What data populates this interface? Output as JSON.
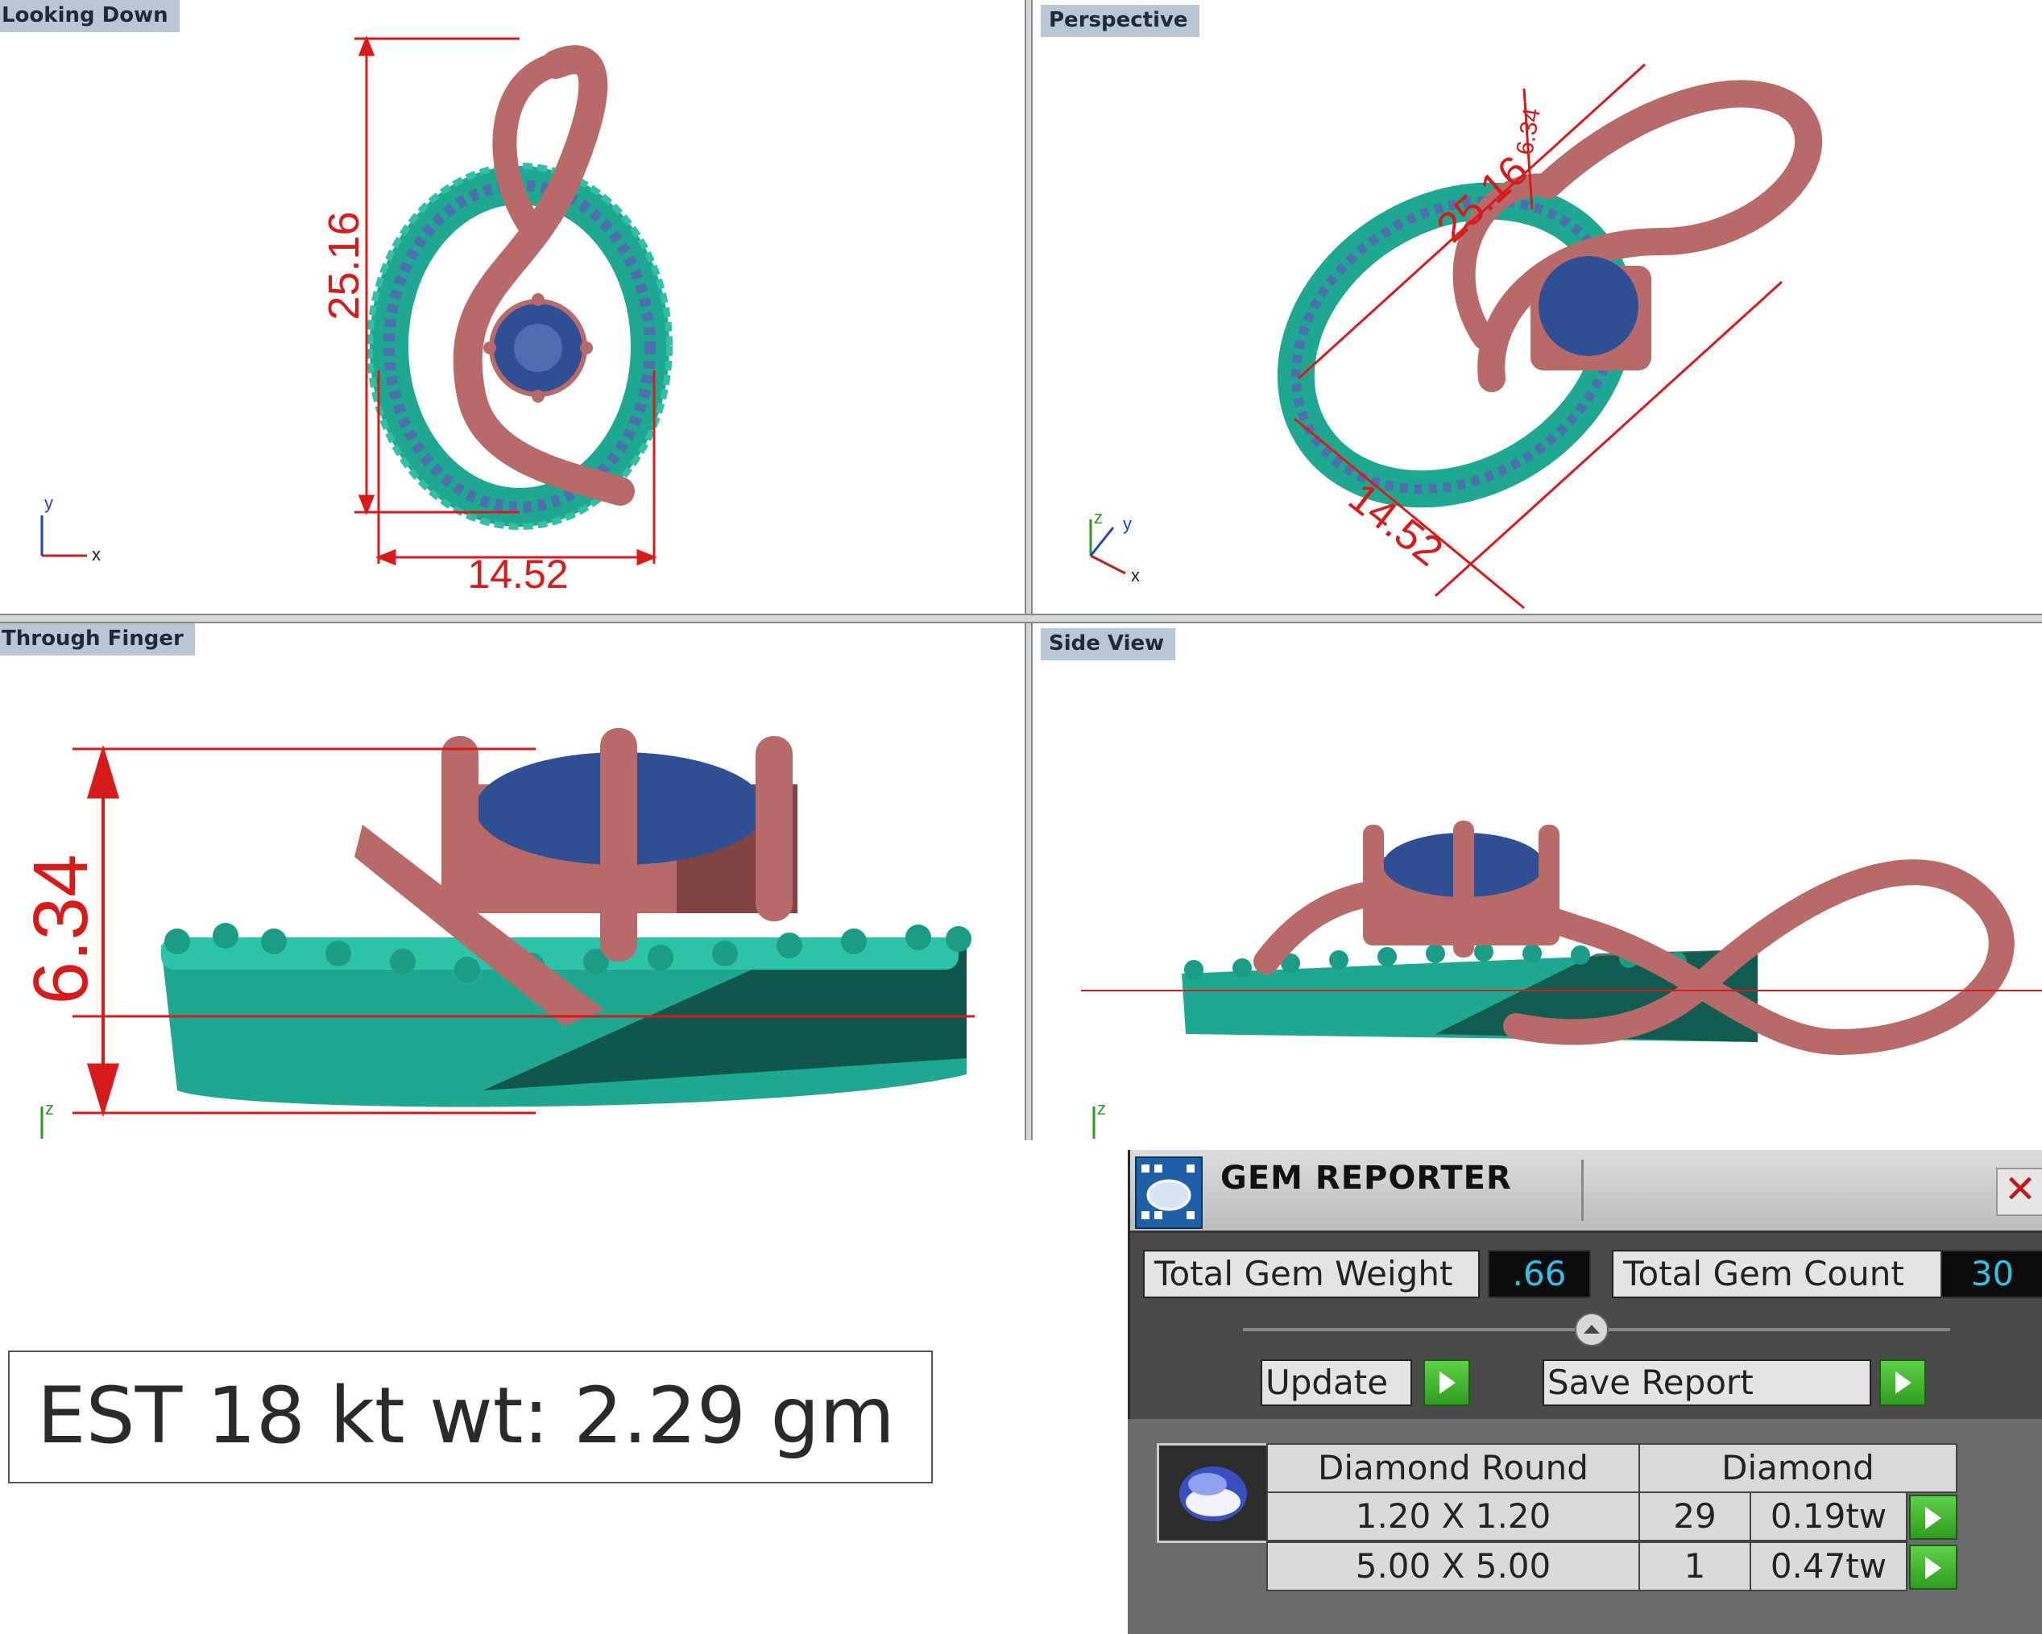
{
  "viewports": {
    "top_left": {
      "label": "Looking Down",
      "dim_height": "25.16",
      "dim_width": "14.52",
      "axis_y": "y",
      "axis_x": "x"
    },
    "top_right": {
      "label": "Perspective",
      "dim_length": "25.16",
      "dim_width": "14.52",
      "dim_small": "6.34",
      "axis_z": "z",
      "axis_y": "y",
      "axis_x": "x"
    },
    "bottom_left": {
      "label": "Through Finger",
      "dim_height": "6.34",
      "axis_z": "z"
    },
    "bottom_right": {
      "label": "Side View",
      "axis_z": "z"
    }
  },
  "estimate": {
    "text": "EST 18 kt wt: 2.29 gm"
  },
  "gem_reporter": {
    "title": "GEM REPORTER",
    "total_weight_label": "Total Gem Weight",
    "total_weight_value": ".66",
    "total_count_label": "Total Gem Count",
    "total_count_value": "30",
    "update_label": "Update",
    "save_report_label": "Save Report",
    "table": {
      "header": [
        "Diamond Round",
        "Diamond"
      ],
      "rows": [
        {
          "size": "1.20 X 1.20",
          "count": "29",
          "weight": "0.19tw"
        },
        {
          "size": "5.00 X 5.00",
          "count": "1",
          "weight": "0.47tw"
        }
      ]
    }
  },
  "colors": {
    "metal": "#b86a68",
    "halo": "#1fa891",
    "stone": "#2f4f94",
    "dimension": "#d91a1a"
  }
}
